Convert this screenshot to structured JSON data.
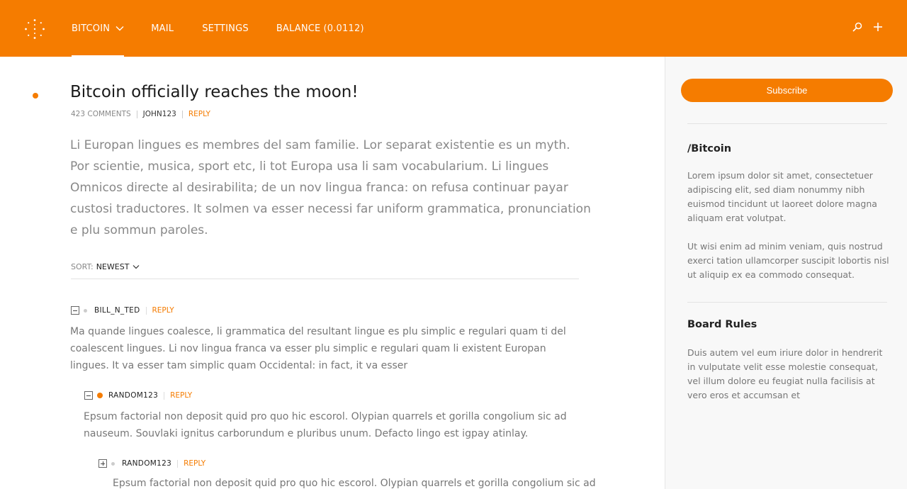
{
  "colors": {
    "accent": "#f57c00",
    "nav_bg": "#f57c00",
    "sidebar_bg": "#f8f8f8"
  },
  "header": {
    "logo_icon": "dotted-circle-logo-icon",
    "nav": [
      {
        "label": "BITCOIN",
        "active": true,
        "has_dropdown": true
      },
      {
        "label": "MAIL"
      },
      {
        "label": "SETTINGS"
      },
      {
        "label": "BALANCE",
        "value": "(0.0112)"
      }
    ],
    "icons": [
      "search-icon",
      "plus-icon"
    ]
  },
  "post": {
    "title": "Bitcoin officially reaches the moon!",
    "comments_count": "423 COMMENTS",
    "author": "JOHN123",
    "reply_label": "REPLY",
    "body": "Li Europan lingues es membres del sam familie. Lor separat existentie es un myth. Por scientie, musica, sport etc, li tot Europa usa li sam vocabularium. Li lingues Omnicos directe al desirabilita; de un nov lingua franca: on refusa continuar payar custosi traductores. It solmen va esser necessi far uniform grammatica, pronunciation e plu sommun paroles."
  },
  "sort": {
    "label": "SORT:",
    "value": "NEWEST"
  },
  "comments": [
    {
      "user": "BILL_N_TED",
      "reply_label": "REPLY",
      "state": "expanded",
      "highlight": false,
      "body": "Ma quande lingues coalesce, li grammatica del resultant lingue es plu simplic e regulari quam ti del coalescent lingues. Li nov lingua franca va esser plu simplic e regulari quam li existent Europan lingues. It va esser tam simplic quam Occidental: in fact, it va esser"
    },
    {
      "user": "RANDOM123",
      "reply_label": "REPLY",
      "state": "expanded",
      "highlight": true,
      "body": "Epsum factorial non deposit quid pro quo hic escorol. Olypian quarrels et gorilla congolium sic ad nauseum. Souvlaki ignitus carborundum e pluribus unum. Defacto lingo est igpay atinlay."
    },
    {
      "user": "RANDOM123",
      "reply_label": "REPLY",
      "state": "collapsed",
      "highlight": false,
      "body": "Epsum factorial non deposit quid pro quo hic escorol. Olypian quarrels et gorilla congolium sic ad"
    }
  ],
  "sidebar": {
    "subscribe_label": "Subscribe",
    "board_title": "/Bitcoin",
    "board_paragraphs": [
      "Lorem ipsum dolor sit amet, consectetuer adipiscing elit, sed diam nonummy nibh euismod tincidunt ut laoreet dolore magna aliquam erat volutpat.",
      "Ut wisi enim ad minim veniam, quis nostrud exerci tation ullamcorper suscipit lobortis nisl ut aliquip ex ea commodo consequat."
    ],
    "rules_title": "Board Rules",
    "rules_text": "Duis autem vel eum iriure dolor in hendrerit in vulputate velit esse molestie consequat, vel illum dolore eu feugiat nulla facilisis at vero eros et accumsan et"
  }
}
